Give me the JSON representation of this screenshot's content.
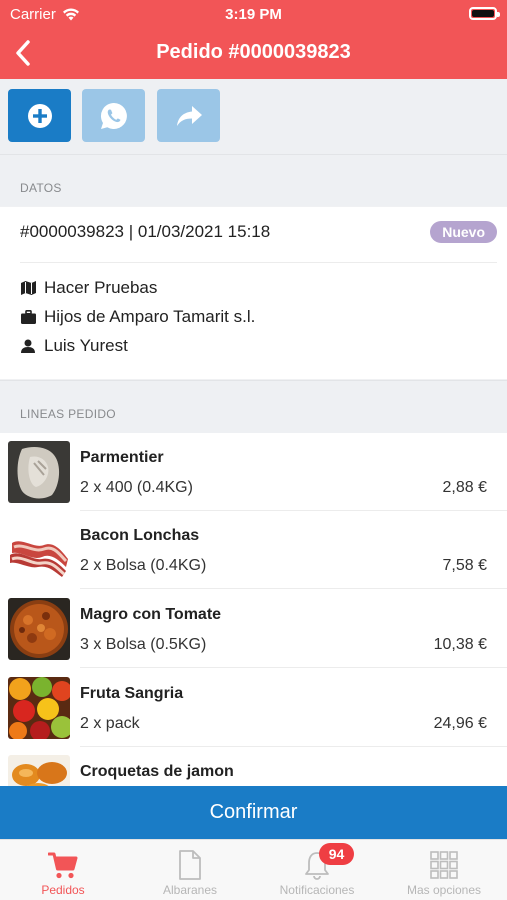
{
  "status_bar": {
    "carrier": "Carrier",
    "time": "3:19 PM"
  },
  "nav": {
    "title": "Pedido #0000039823"
  },
  "actions": [
    {
      "icon": "plus-circle-icon"
    },
    {
      "icon": "whatsapp-icon"
    },
    {
      "icon": "share-icon"
    }
  ],
  "datos": {
    "section_title": "DATOS",
    "order_line": "#0000039823 | 01/03/2021 15:18",
    "status_badge": "Nuevo",
    "rows": [
      {
        "icon": "map-icon",
        "text": "Hacer Pruebas"
      },
      {
        "icon": "briefcase-icon",
        "text": "Hijos de Amparo Tamarit s.l."
      },
      {
        "icon": "person-icon",
        "text": "Luis Yurest"
      }
    ]
  },
  "lines": {
    "section_title": "LINEAS PEDIDO",
    "items": [
      {
        "name": "Parmentier",
        "qty": "2 x 400 (0.4KG)",
        "price": "2,88 €"
      },
      {
        "name": "Bacon Lonchas",
        "qty": "2 x Bolsa (0.4KG)",
        "price": "7,58 €"
      },
      {
        "name": "Magro con Tomate",
        "qty": "3 x Bolsa (0.5KG)",
        "price": "10,38 €"
      },
      {
        "name": "Fruta Sangria",
        "qty": "2 x pack",
        "price": "24,96 €"
      },
      {
        "name": "Croquetas de jamon",
        "qty": "",
        "price": ""
      }
    ]
  },
  "confirm_label": "Confirmar",
  "tabs": [
    {
      "label": "Pedidos",
      "icon": "cart-icon",
      "active": true
    },
    {
      "label": "Albaranes",
      "icon": "document-icon",
      "active": false
    },
    {
      "label": "Notificaciones",
      "icon": "bell-icon",
      "active": false,
      "badge": "94"
    },
    {
      "label": "Mas opciones",
      "icon": "grid-icon",
      "active": false
    }
  ],
  "colors": {
    "header": "#f25557",
    "primary": "#1a7cc6",
    "badge": "#b5a4cf",
    "notif_badge": "#ef3e43"
  }
}
